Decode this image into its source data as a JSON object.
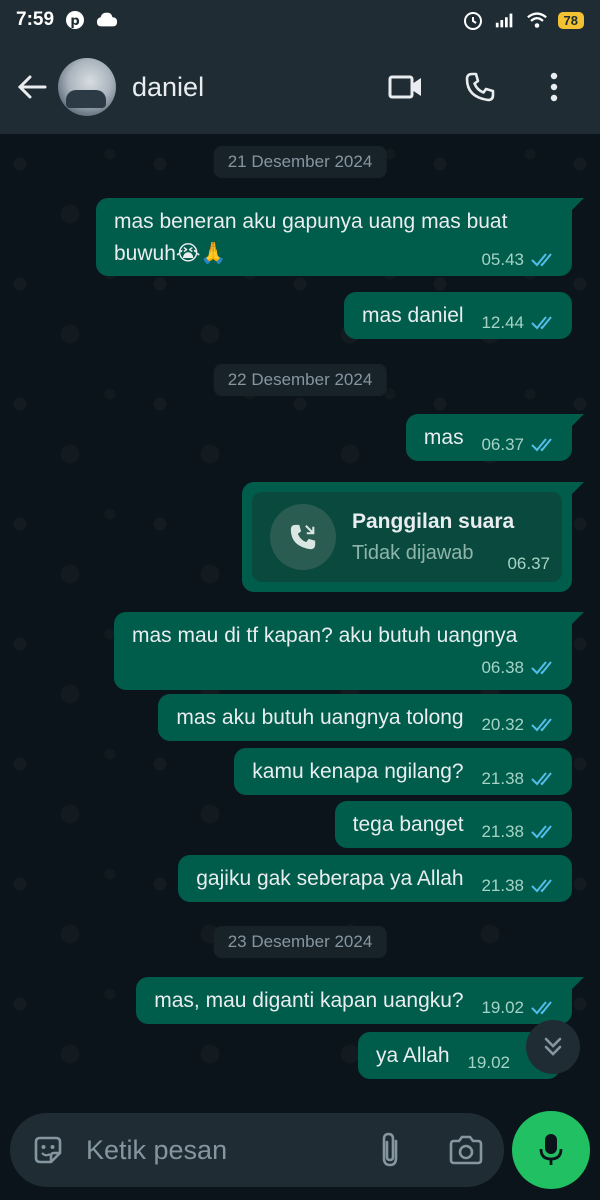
{
  "status_bar": {
    "time": "7:59",
    "battery": "78"
  },
  "header": {
    "contact_name": "daniel"
  },
  "dates": [
    "21 Desember 2024",
    "22 Desember 2024",
    "23 Desember 2024"
  ],
  "messages": [
    {
      "line1": "mas beneran aku gapunya uang mas buat",
      "line2": "buwuh😭🙏",
      "time": "05.43"
    },
    {
      "text": "mas daniel",
      "time": "12.44"
    },
    {
      "text": "mas",
      "time": "06.37"
    },
    {
      "text": "mas mau di tf kapan? aku butuh uangnya",
      "time": "06.38"
    },
    {
      "text": "mas aku butuh uangnya tolong",
      "time": "20.32"
    },
    {
      "text": "kamu kenapa ngilang?",
      "time": "21.38"
    },
    {
      "text": "tega banget",
      "time": "21.38"
    },
    {
      "text": "gajiku gak seberapa ya Allah",
      "time": "21.38"
    },
    {
      "text": "mas, mau diganti kapan uangku?",
      "time": "19.02"
    },
    {
      "text": "ya Allah",
      "time": "19.02"
    }
  ],
  "call": {
    "title": "Panggilan suara",
    "status": "Tidak dijawab",
    "time": "06.37"
  },
  "input": {
    "placeholder": "Ketik pesan"
  },
  "colors": {
    "outgoing_bubble": "#005c4b",
    "read_ticks": "#53bdeb",
    "mic_button": "#21c063",
    "background": "#0b141a"
  }
}
